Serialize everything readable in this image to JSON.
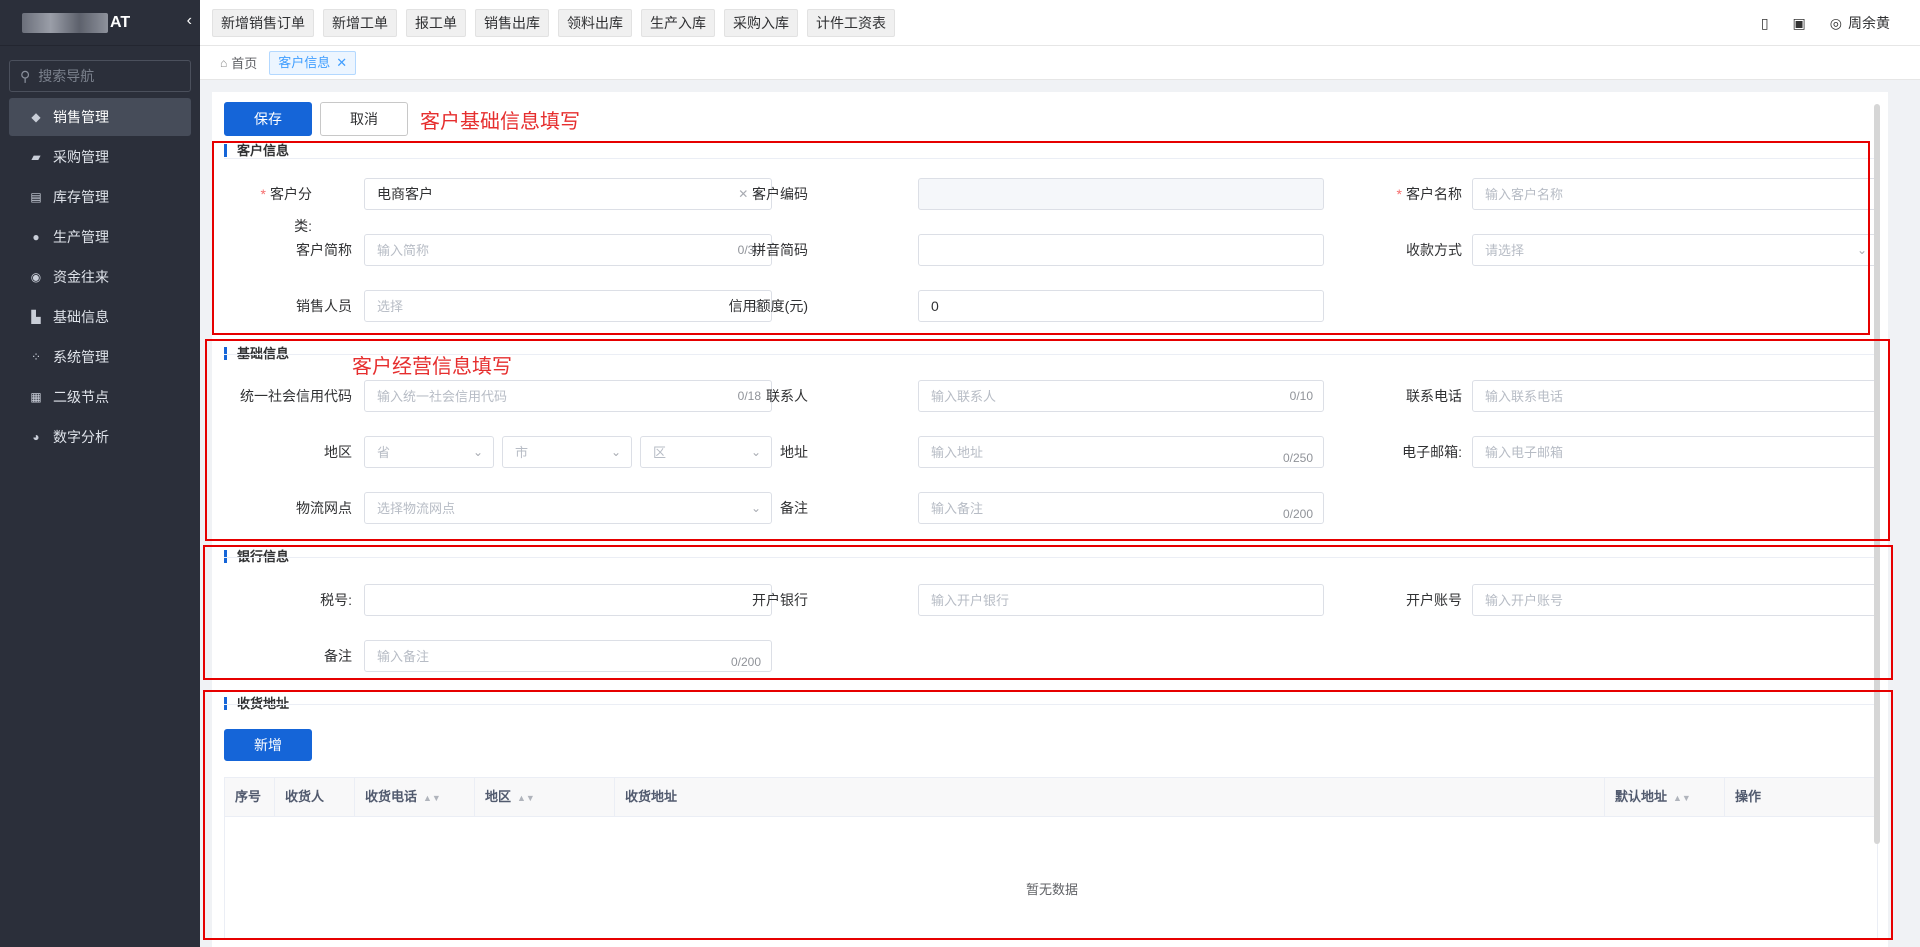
{
  "sidebar": {
    "logo_text": "AT",
    "search_placeholder": "搜索导航",
    "items": [
      {
        "label": "销售管理",
        "icon": "tag-icon",
        "active": true
      },
      {
        "label": "采购管理",
        "icon": "cart-icon"
      },
      {
        "label": "库存管理",
        "icon": "warehouse-icon"
      },
      {
        "label": "生产管理",
        "icon": "production-icon"
      },
      {
        "label": "资金往来",
        "icon": "money-icon"
      },
      {
        "label": "基础信息",
        "icon": "info-icon"
      },
      {
        "label": "系统管理",
        "icon": "system-icon"
      },
      {
        "label": "二级节点",
        "icon": "node-icon"
      },
      {
        "label": "数字分析",
        "icon": "pie-chart-icon"
      }
    ]
  },
  "topbar": {
    "quick_buttons": [
      "新增销售订单",
      "新增工单",
      "报工单",
      "销售出库",
      "领料出库",
      "生产入库",
      "采购入库",
      "计件工资表"
    ],
    "user": "周余黄"
  },
  "tags": {
    "home": "首页",
    "active": "客户信息"
  },
  "actions": {
    "save": "保存",
    "cancel": "取消"
  },
  "annotations": {
    "basic": "客户基础信息填写",
    "business": "客户经营信息填写"
  },
  "customer_info": {
    "title": "客户信息",
    "category_label": "客户分类:",
    "category_value": "电商客户",
    "code_label": "客户编码",
    "name_label": "客户名称",
    "name_placeholder": "输入客户名称",
    "short_label": "客户简称",
    "short_placeholder": "输入简称",
    "short_count": "0/30",
    "pinyin_label": "拼音简码",
    "payment_label": "收款方式",
    "payment_placeholder": "请选择",
    "sales_label": "销售人员",
    "sales_placeholder": "选择",
    "credit_label": "信用额度(元)",
    "credit_value": "0"
  },
  "basic_info": {
    "title": "基础信息",
    "credit_code_label": "统一社会信用代码",
    "credit_code_placeholder": "输入统一社会信用代码",
    "credit_code_count": "0/18",
    "contact_label": "联系人",
    "contact_placeholder": "输入联系人",
    "contact_count": "0/10",
    "phone_label": "联系电话",
    "phone_placeholder": "输入联系电话",
    "region_label": "地区",
    "province_placeholder": "省",
    "city_placeholder": "市",
    "district_placeholder": "区",
    "address_label": "地址",
    "address_placeholder": "输入地址",
    "address_count": "0/250",
    "email_label": "电子邮箱:",
    "email_placeholder": "输入电子邮箱",
    "logistics_label": "物流网点",
    "logistics_placeholder": "选择物流网点",
    "remark_label": "备注",
    "remark_placeholder": "输入备注",
    "remark_count": "0/200"
  },
  "bank_info": {
    "title": "银行信息",
    "tax_label": "税号:",
    "bank_label": "开户银行",
    "bank_placeholder": "输入开户银行",
    "account_label": "开户账号",
    "account_placeholder": "输入开户账号",
    "remark_label": "备注",
    "remark_placeholder": "输入备注",
    "remark_count": "0/200"
  },
  "shipping": {
    "title": "收货地址",
    "add_button": "新增",
    "columns": [
      "序号",
      "收货人",
      "收货电话",
      "地区",
      "收货地址",
      "默认地址",
      "操作"
    ],
    "empty_text": "暂无数据"
  },
  "colors": {
    "primary": "#1565d8",
    "sidebar_bg": "#2b2f3a",
    "annotation": "#e62e2e"
  }
}
